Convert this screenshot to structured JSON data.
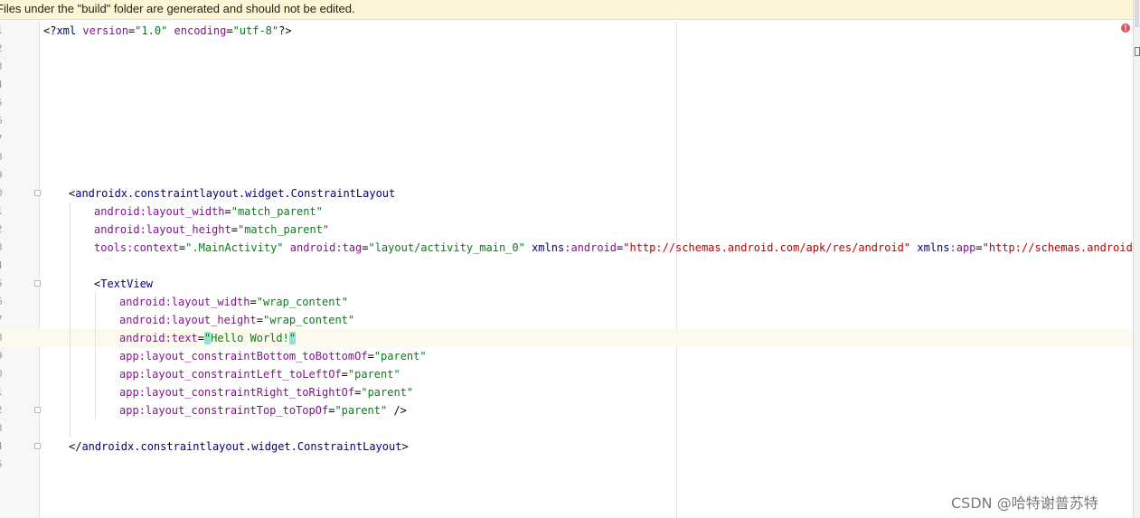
{
  "banner": {
    "text": "Files under the \"build\" folder are generated and should not be edited."
  },
  "editor": {
    "lines": [
      {
        "num": "1",
        "tokens": [
          {
            "t": "<?",
            "c": "pun"
          },
          {
            "t": "xml",
            "c": "tag"
          },
          {
            "t": " version",
            "c": "attr"
          },
          {
            "t": "=",
            "c": "pun"
          },
          {
            "t": "\"1.0\"",
            "c": "val"
          },
          {
            "t": " encoding",
            "c": "attr"
          },
          {
            "t": "=",
            "c": "pun"
          },
          {
            "t": "\"utf-8\"",
            "c": "val"
          },
          {
            "t": "?>",
            "c": "pun"
          }
        ]
      },
      {
        "num": "2",
        "tokens": []
      },
      {
        "num": "3",
        "tokens": []
      },
      {
        "num": "4",
        "tokens": []
      },
      {
        "num": "5",
        "tokens": []
      },
      {
        "num": "6",
        "tokens": []
      },
      {
        "num": "7",
        "tokens": []
      },
      {
        "num": "8",
        "tokens": []
      },
      {
        "num": "9",
        "tokens": []
      },
      {
        "num": "0",
        "indent": 4,
        "fold": "open",
        "tokens": [
          {
            "t": "<",
            "c": "pun"
          },
          {
            "t": "androidx.constraintlayout.widget.ConstraintLayout",
            "c": "tag"
          }
        ]
      },
      {
        "num": "1",
        "indent": 8,
        "tokens": [
          {
            "t": "android",
            "c": "ns"
          },
          {
            "t": ":layout_width",
            "c": "attr"
          },
          {
            "t": "=",
            "c": "pun"
          },
          {
            "t": "\"match_parent\"",
            "c": "val"
          }
        ]
      },
      {
        "num": "2",
        "indent": 8,
        "tokens": [
          {
            "t": "android",
            "c": "ns"
          },
          {
            "t": ":layout_height",
            "c": "attr"
          },
          {
            "t": "=",
            "c": "pun"
          },
          {
            "t": "\"match_parent\"",
            "c": "val"
          }
        ]
      },
      {
        "num": "3",
        "indent": 8,
        "tokens": [
          {
            "t": "tools",
            "c": "ns"
          },
          {
            "t": ":context",
            "c": "attr"
          },
          {
            "t": "=",
            "c": "pun"
          },
          {
            "t": "\".MainActivity\"",
            "c": "val"
          },
          {
            "t": " android",
            "c": "ns"
          },
          {
            "t": ":tag",
            "c": "attr"
          },
          {
            "t": "=",
            "c": "pun"
          },
          {
            "t": "\"layout/activity_main_0\"",
            "c": "val"
          },
          {
            "t": " xmlns",
            "c": "tag"
          },
          {
            "t": ":android",
            "c": "attr"
          },
          {
            "t": "=",
            "c": "pun"
          },
          {
            "t": "\"http://schemas.android.com/apk/res/android\"",
            "c": "url"
          },
          {
            "t": " xmlns",
            "c": "tag"
          },
          {
            "t": ":app",
            "c": "attr"
          },
          {
            "t": "=",
            "c": "pun"
          },
          {
            "t": "\"http://schemas.android.com/",
            "c": "url"
          }
        ]
      },
      {
        "num": "4",
        "tokens": []
      },
      {
        "num": "5",
        "indent": 8,
        "fold": "open",
        "tokens": [
          {
            "t": "<",
            "c": "pun"
          },
          {
            "t": "TextView",
            "c": "tag"
          }
        ]
      },
      {
        "num": "6",
        "indent": 12,
        "tokens": [
          {
            "t": "android",
            "c": "ns"
          },
          {
            "t": ":layout_width",
            "c": "attr"
          },
          {
            "t": "=",
            "c": "pun"
          },
          {
            "t": "\"wrap_content\"",
            "c": "val"
          }
        ]
      },
      {
        "num": "7",
        "indent": 12,
        "tokens": [
          {
            "t": "android",
            "c": "ns"
          },
          {
            "t": ":layout_height",
            "c": "attr"
          },
          {
            "t": "=",
            "c": "pun"
          },
          {
            "t": "\"wrap_content\"",
            "c": "val"
          }
        ]
      },
      {
        "num": "8",
        "indent": 12,
        "current": true,
        "tokens": [
          {
            "t": "android",
            "c": "ns"
          },
          {
            "t": ":text",
            "c": "attr"
          },
          {
            "t": "=",
            "c": "pun"
          },
          {
            "t": "\"",
            "c": "val hl"
          },
          {
            "t": "Hello World!",
            "c": "val"
          },
          {
            "t": "\"",
            "c": "val hl"
          }
        ]
      },
      {
        "num": "9",
        "indent": 12,
        "tokens": [
          {
            "t": "app",
            "c": "ns"
          },
          {
            "t": ":layout_constraintBottom_toBottomOf",
            "c": "attr"
          },
          {
            "t": "=",
            "c": "pun"
          },
          {
            "t": "\"parent\"",
            "c": "val"
          }
        ]
      },
      {
        "num": "0",
        "indent": 12,
        "tokens": [
          {
            "t": "app",
            "c": "ns"
          },
          {
            "t": ":layout_constraintLeft_toLeftOf",
            "c": "attr"
          },
          {
            "t": "=",
            "c": "pun"
          },
          {
            "t": "\"parent\"",
            "c": "val"
          }
        ]
      },
      {
        "num": "1",
        "indent": 12,
        "tokens": [
          {
            "t": "app",
            "c": "ns"
          },
          {
            "t": ":layout_constraintRight_toRightOf",
            "c": "attr"
          },
          {
            "t": "=",
            "c": "pun"
          },
          {
            "t": "\"parent\"",
            "c": "val"
          }
        ]
      },
      {
        "num": "2",
        "indent": 12,
        "fold": "close",
        "tokens": [
          {
            "t": "app",
            "c": "ns"
          },
          {
            "t": ":layout_constraintTop_toTopOf",
            "c": "attr"
          },
          {
            "t": "=",
            "c": "pun"
          },
          {
            "t": "\"parent\"",
            "c": "val"
          },
          {
            "t": " />",
            "c": "pun"
          }
        ]
      },
      {
        "num": "3",
        "tokens": []
      },
      {
        "num": "4",
        "indent": 4,
        "fold": "close",
        "tokens": [
          {
            "t": "</",
            "c": "pun"
          },
          {
            "t": "androidx.constraintlayout.widget.ConstraintLayout",
            "c": "tag"
          },
          {
            "t": ">",
            "c": "pun"
          }
        ]
      },
      {
        "num": "5",
        "tokens": []
      }
    ]
  },
  "error_icon": {
    "glyph": "!",
    "color": "#e05555"
  },
  "watermark": {
    "text": "CSDN @哈特谢普苏特"
  }
}
